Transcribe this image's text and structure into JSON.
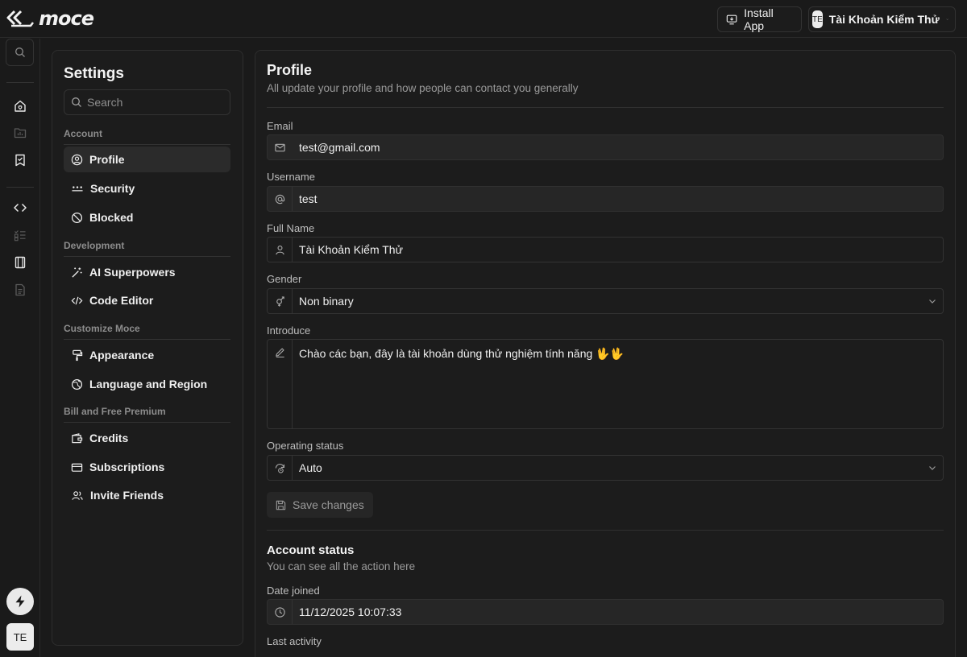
{
  "app": {
    "brand": "moce",
    "install_label": "Install App",
    "account_initials": "TE",
    "account_name": "Tài Khoản Kiểm Thử"
  },
  "settings": {
    "title": "Settings",
    "search_placeholder": "Search",
    "groups": [
      {
        "label": "Account",
        "items": [
          {
            "label": "Profile",
            "icon": "user-circle-icon",
            "active": true
          },
          {
            "label": "Security",
            "icon": "password-dots-icon"
          },
          {
            "label": "Blocked",
            "icon": "blocked-icon"
          }
        ]
      },
      {
        "label": "Development",
        "items": [
          {
            "label": "AI Superpowers",
            "icon": "magic-wand-icon"
          },
          {
            "label": "Code Editor",
            "icon": "code-icon"
          }
        ]
      },
      {
        "label": "Customize Moce",
        "items": [
          {
            "label": "Appearance",
            "icon": "paint-roller-icon"
          },
          {
            "label": "Language and Region",
            "icon": "globe-icon"
          }
        ]
      },
      {
        "label": "Bill and Free Premium",
        "items": [
          {
            "label": "Credits",
            "icon": "wallet-icon"
          },
          {
            "label": "Subscriptions",
            "icon": "credit-card-icon"
          },
          {
            "label": "Invite Friends",
            "icon": "users-icon"
          }
        ]
      }
    ]
  },
  "profile": {
    "title": "Profile",
    "subtitle": "All update your profile and how people can contact you generally",
    "email_label": "Email",
    "email_value": "test@gmail.com",
    "username_label": "Username",
    "username_value": "test",
    "fullname_label": "Full Name",
    "fullname_value": "Tài Khoản Kiểm Thử",
    "gender_label": "Gender",
    "gender_value": "Non binary",
    "introduce_label": "Introduce",
    "introduce_value": "Chào các bạn, đây là tài khoản dùng thử nghiệm tính năng 🖖🖖",
    "status_label": "Operating status",
    "status_value": "Auto",
    "save_label": "Save changes"
  },
  "account_status": {
    "title": "Account status",
    "subtitle": "You can see all the action here",
    "date_joined_label": "Date joined",
    "date_joined_value": "11/12/2025 10:07:33",
    "last_activity_label": "Last activity"
  }
}
